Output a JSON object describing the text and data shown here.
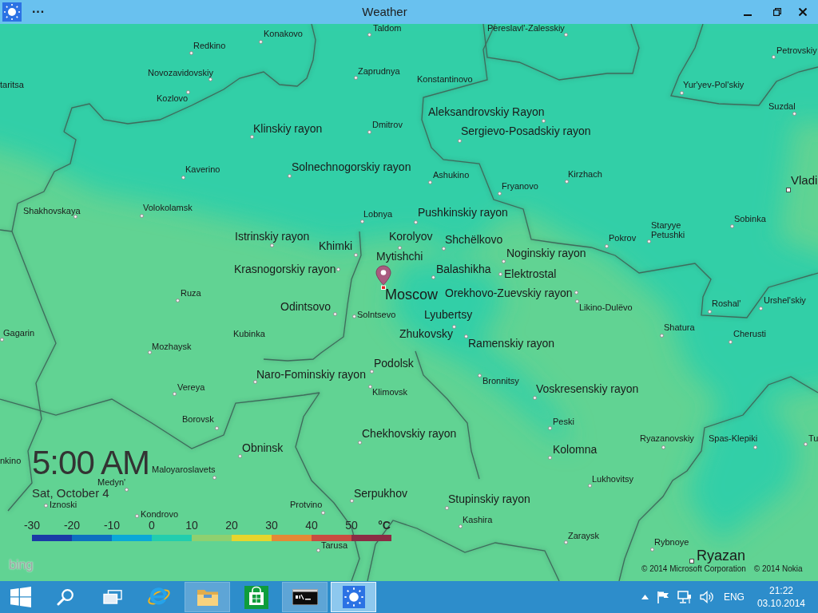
{
  "window": {
    "title": "Weather",
    "more_glyph": "···"
  },
  "map_labels": [
    {
      "name": "Taldom",
      "kind": "town"
    },
    {
      "name": "Pereslavl'-Zalesskiy",
      "kind": "town"
    },
    {
      "name": "Konakovo",
      "kind": "town"
    },
    {
      "name": "Redkino",
      "kind": "town"
    },
    {
      "name": "Petrovskiy",
      "kind": "town"
    },
    {
      "name": "Novozavidovskiy",
      "kind": "town"
    },
    {
      "name": "Zaprudnya",
      "kind": "town"
    },
    {
      "name": "Konstantinovo",
      "kind": "town"
    },
    {
      "name": "taritsa",
      "kind": "town"
    },
    {
      "name": "Yur'yev-Pol'skiy",
      "kind": "town"
    },
    {
      "name": "Kozlovo",
      "kind": "town"
    },
    {
      "name": "Suzdal",
      "kind": "town"
    },
    {
      "name": "Aleksandrovskiy Rayon",
      "kind": "district"
    },
    {
      "name": "Klinskiy rayon",
      "kind": "district"
    },
    {
      "name": "Dmitrov",
      "kind": "town"
    },
    {
      "name": "Sergievo-Posadskiy rayon",
      "kind": "district"
    },
    {
      "name": "Kaverino",
      "kind": "town"
    },
    {
      "name": "Solnechnogorskiy rayon",
      "kind": "district"
    },
    {
      "name": "Ashukino",
      "kind": "town"
    },
    {
      "name": "Kirzhach",
      "kind": "town"
    },
    {
      "name": "Vladi",
      "kind": "city"
    },
    {
      "name": "Fryanovo",
      "kind": "town"
    },
    {
      "name": "Shakhovskaya",
      "kind": "town"
    },
    {
      "name": "Volokolamsk",
      "kind": "town"
    },
    {
      "name": "Lobnya",
      "kind": "town"
    },
    {
      "name": "Pushkinskiy rayon",
      "kind": "district"
    },
    {
      "name": "Sobinka",
      "kind": "town"
    },
    {
      "name": "Istrinskiy rayon",
      "kind": "district"
    },
    {
      "name": "Korolyov",
      "kind": "district"
    },
    {
      "name": "Shchëlkovo",
      "kind": "district"
    },
    {
      "name": "Pokrov",
      "kind": "town"
    },
    {
      "name": "Staryye Petushki",
      "kind": "town"
    },
    {
      "name": "Khimki",
      "kind": "district"
    },
    {
      "name": "Mytishchi",
      "kind": "district"
    },
    {
      "name": "Noginskiy rayon",
      "kind": "district"
    },
    {
      "name": "Krasnogorskiy rayon",
      "kind": "district"
    },
    {
      "name": "Balashikha",
      "kind": "district"
    },
    {
      "name": "Elektrostal",
      "kind": "district"
    },
    {
      "name": "Ruza",
      "kind": "town"
    },
    {
      "name": "Moscow",
      "kind": "city"
    },
    {
      "name": "Orekhovo-Zuevskiy rayon",
      "kind": "district"
    },
    {
      "name": "Odintsovo",
      "kind": "district"
    },
    {
      "name": "Solntsevo",
      "kind": "town"
    },
    {
      "name": "Lyubertsy",
      "kind": "district"
    },
    {
      "name": "Likino-Dulëvo",
      "kind": "town"
    },
    {
      "name": "Roshal'",
      "kind": "town"
    },
    {
      "name": "Urshel'skiy",
      "kind": "town"
    },
    {
      "name": "Shatura",
      "kind": "town"
    },
    {
      "name": "Gagarin",
      "kind": "town"
    },
    {
      "name": "Kubinka",
      "kind": "town"
    },
    {
      "name": "Zhukovsky",
      "kind": "district"
    },
    {
      "name": "Cherusti",
      "kind": "town"
    },
    {
      "name": "Mozhaysk",
      "kind": "town"
    },
    {
      "name": "Ramenskiy rayon",
      "kind": "district"
    },
    {
      "name": "Podolsk",
      "kind": "district"
    },
    {
      "name": "Naro-Fominskiy rayon",
      "kind": "district"
    },
    {
      "name": "Bronnitsy",
      "kind": "town"
    },
    {
      "name": "Vereya",
      "kind": "town"
    },
    {
      "name": "Klimovsk",
      "kind": "town"
    },
    {
      "name": "Voskresenskiy rayon",
      "kind": "district"
    },
    {
      "name": "Borovsk",
      "kind": "town"
    },
    {
      "name": "Peski",
      "kind": "town"
    },
    {
      "name": "Chekhovskiy rayon",
      "kind": "district"
    },
    {
      "name": "Ryazanovskiy",
      "kind": "town"
    },
    {
      "name": "Spas-Klepiki",
      "kind": "town"
    },
    {
      "name": "Tu",
      "kind": "town"
    },
    {
      "name": "Obninsk",
      "kind": "district"
    },
    {
      "name": "Kolomna",
      "kind": "district"
    },
    {
      "name": "nkino",
      "kind": "town"
    },
    {
      "name": "Maloyaroslavets",
      "kind": "town"
    },
    {
      "name": "Medyn'",
      "kind": "town"
    },
    {
      "name": "Lukhovitsy",
      "kind": "town"
    },
    {
      "name": "Serpukhov",
      "kind": "district"
    },
    {
      "name": "Iznoski",
      "kind": "town"
    },
    {
      "name": "Protvino",
      "kind": "town"
    },
    {
      "name": "Stupinskiy rayon",
      "kind": "district"
    },
    {
      "name": "Kondrovo",
      "kind": "town"
    },
    {
      "name": "Kashira",
      "kind": "town"
    },
    {
      "name": "Zaraysk",
      "kind": "town"
    },
    {
      "name": "Tarusa",
      "kind": "town"
    },
    {
      "name": "Rybnoye",
      "kind": "town"
    },
    {
      "name": "Ryazan",
      "kind": "city"
    }
  ],
  "time_overlay": {
    "time": "5:00 AM",
    "date": "Sat, October 4"
  },
  "legend": {
    "labels": [
      "-30",
      "-20",
      "-10",
      "0",
      "10",
      "20",
      "30",
      "40",
      "50"
    ],
    "unit": "°C",
    "segments": [
      {
        "color": "#1a3aa6"
      },
      {
        "color": "#0d70c0"
      },
      {
        "color": "#0aa8d8"
      },
      {
        "color": "#22cdae"
      },
      {
        "color": "#8fd06f"
      },
      {
        "color": "#e7d52c"
      },
      {
        "color": "#e58936"
      },
      {
        "color": "#c94c40"
      },
      {
        "color": "#8b2c44"
      }
    ]
  },
  "attribution": {
    "logo": "bing",
    "copyrights": [
      "© 2014 Microsoft Corporation",
      "© 2014 Nokia"
    ]
  },
  "taskbar": {
    "buttons": [
      {
        "kind": "start"
      },
      {
        "kind": "search"
      },
      {
        "kind": "task-view"
      }
    ],
    "apps": [
      {
        "kind": "browser",
        "running": false,
        "selected": false
      },
      {
        "kind": "file-explorer",
        "running": true,
        "selected": false
      },
      {
        "kind": "store",
        "running": false,
        "selected": false
      },
      {
        "kind": "command-prompt",
        "running": true,
        "selected": false
      },
      {
        "kind": "weather",
        "running": true,
        "selected": true
      }
    ],
    "tray": {
      "icons": [
        {
          "kind": "show-hidden"
        },
        {
          "kind": "flag"
        },
        {
          "kind": "network"
        },
        {
          "kind": "volume"
        }
      ],
      "language": "ENG",
      "time": "21:22",
      "date": "03.10.2014"
    }
  }
}
